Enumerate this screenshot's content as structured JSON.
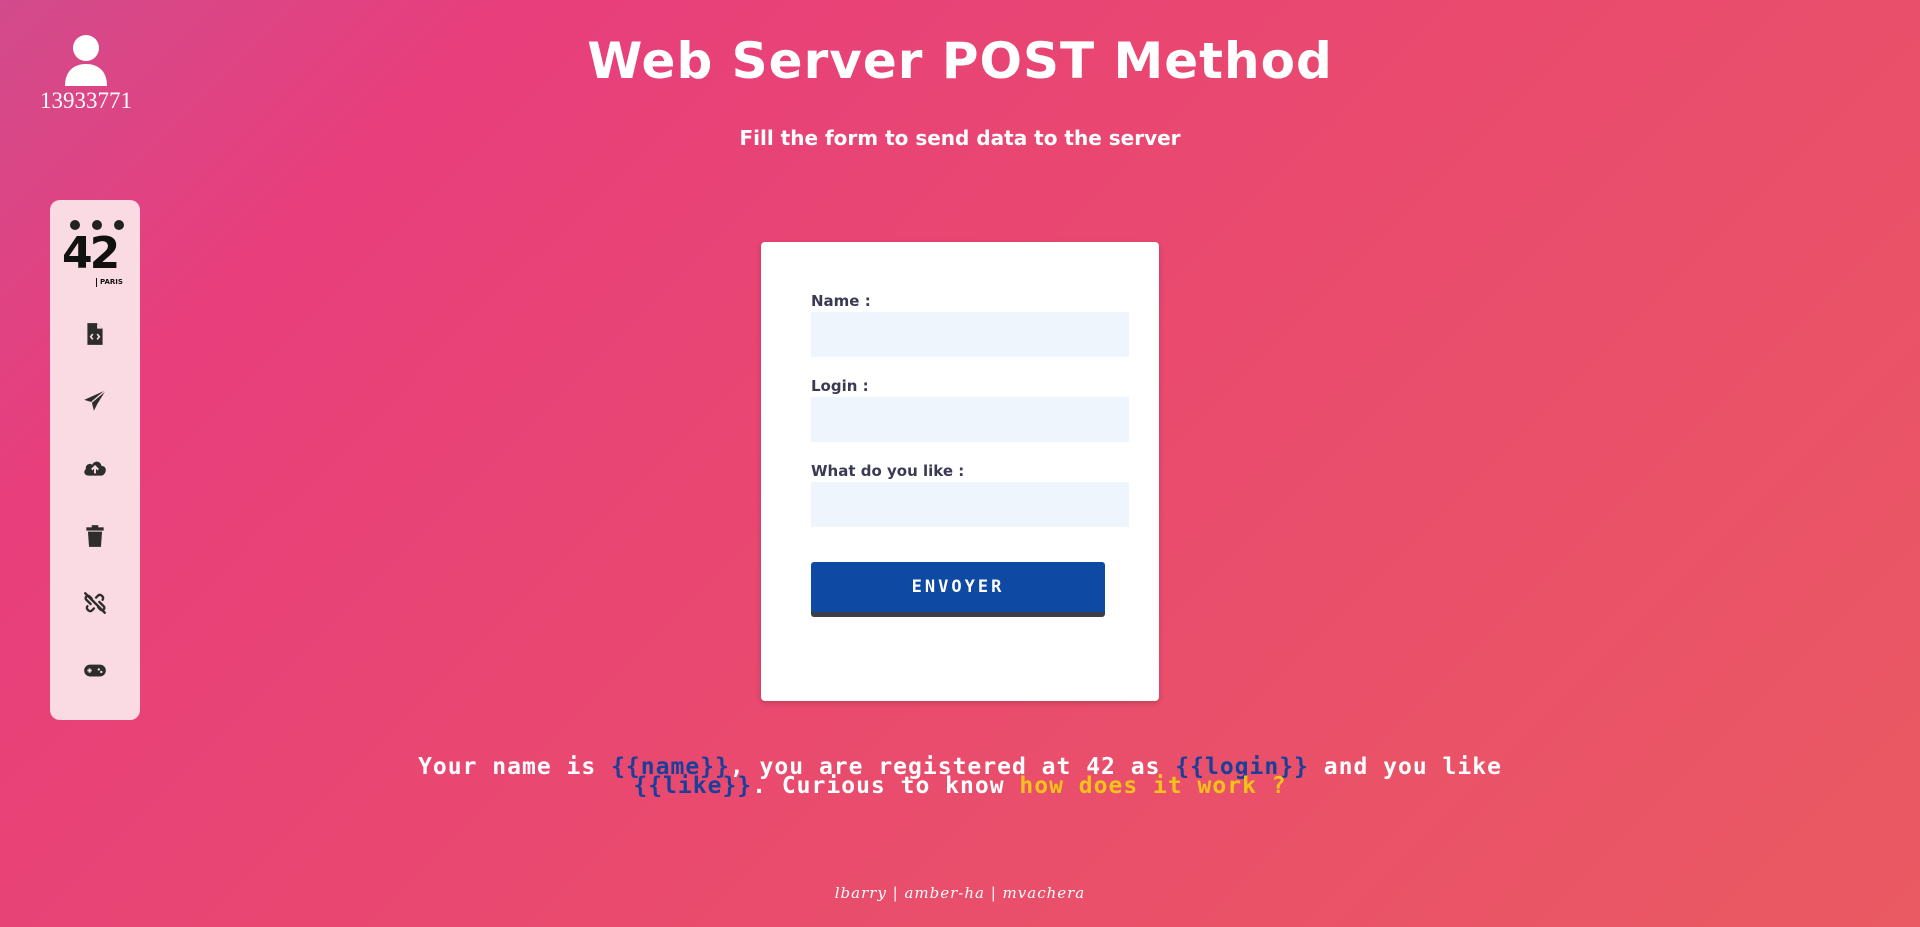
{
  "user": {
    "id": "13933771",
    "icon": "user-icon"
  },
  "header": {
    "title": "Web Server POST Method",
    "subtitle": "Fill the form to send data to the server"
  },
  "sidebar": {
    "logo": {
      "number": "42",
      "label": "PARIS"
    },
    "items": [
      {
        "icon": "file-code-icon"
      },
      {
        "icon": "paper-plane-icon"
      },
      {
        "icon": "cloud-upload-icon"
      },
      {
        "icon": "trash-icon"
      },
      {
        "icon": "broken-link-icon"
      },
      {
        "icon": "gamepad-icon"
      }
    ]
  },
  "form": {
    "name_label": "Name :",
    "name_value": "",
    "login_label": "Login :",
    "login_value": "",
    "like_label": "What do you like :",
    "like_value": "",
    "submit_label": "ENVOYER"
  },
  "result": {
    "part1": "Your name is ",
    "name_tpl": "{{name}}",
    "part2": ", you are registered at 42 as ",
    "login_tpl": "{{login}}",
    "part3": " and you like",
    "like_tpl": "{{like}}",
    "part4": ". Curious to know ",
    "link_text": "how does it work ?"
  },
  "footer": {
    "credits": "lbarry | amber-ha | mvachera"
  },
  "colors": {
    "accent_blue": "#0e4aa3",
    "template_blue": "#1a3f9a",
    "link_yellow": "#f4c21b",
    "sidebar_bg": "#fadbe3"
  }
}
